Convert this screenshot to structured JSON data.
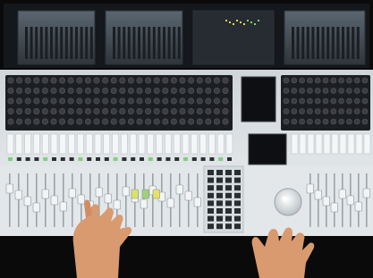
{
  "scene": {
    "subject": "mixing-console",
    "colors": {
      "background": "#0a0a0a",
      "monitor_bezel": "#1a1d22",
      "monitor_screen": "#4a555e",
      "surface": "#e8ecee",
      "knob_field": "#1c1e21",
      "knob": "#3a3d42",
      "fader_cap": "#f2f4f5",
      "fader_slot": "#9aa3a8",
      "screen": "#0e0f12",
      "led_green": "#7fd17a",
      "led_yellow": "#f1d24a",
      "skin": "#d89a6e",
      "jog_wheel": "#f0f2f4"
    }
  }
}
